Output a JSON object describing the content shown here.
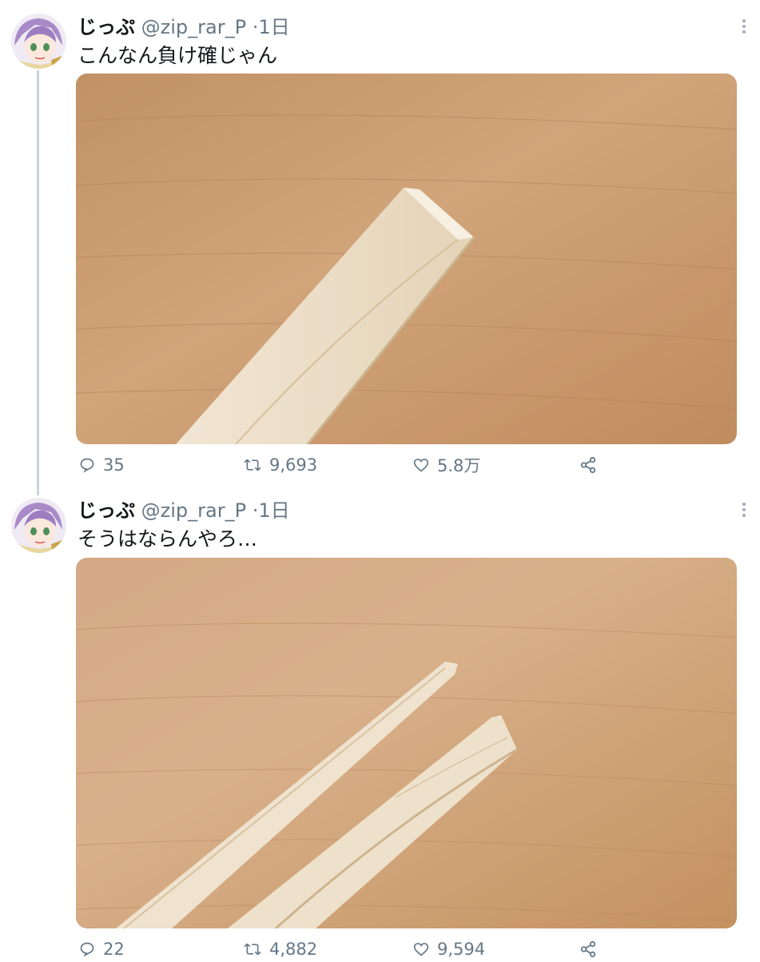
{
  "tweets": [
    {
      "name": "じっぷ",
      "handle": "@zip_rar_P",
      "time": "·1日",
      "text": "こんなん負け確じゃん",
      "replies": "35",
      "retweets": "9,693",
      "likes": "5.8万"
    },
    {
      "name": "じっぷ",
      "handle": "@zip_rar_P",
      "time": "·1日",
      "text": "そうはならんやろ…",
      "replies": "22",
      "retweets": "4,882",
      "likes": "9,594"
    }
  ],
  "icons": {
    "reply": "speech-bubble",
    "retweet": "retweet-arrows",
    "like": "heart",
    "share": "share-nodes",
    "more": "vertical-ellipsis"
  },
  "colors": {
    "text": "#14171a",
    "secondary": "#657786",
    "thread_line": "#c9d4dc",
    "wood": "#c99869"
  }
}
